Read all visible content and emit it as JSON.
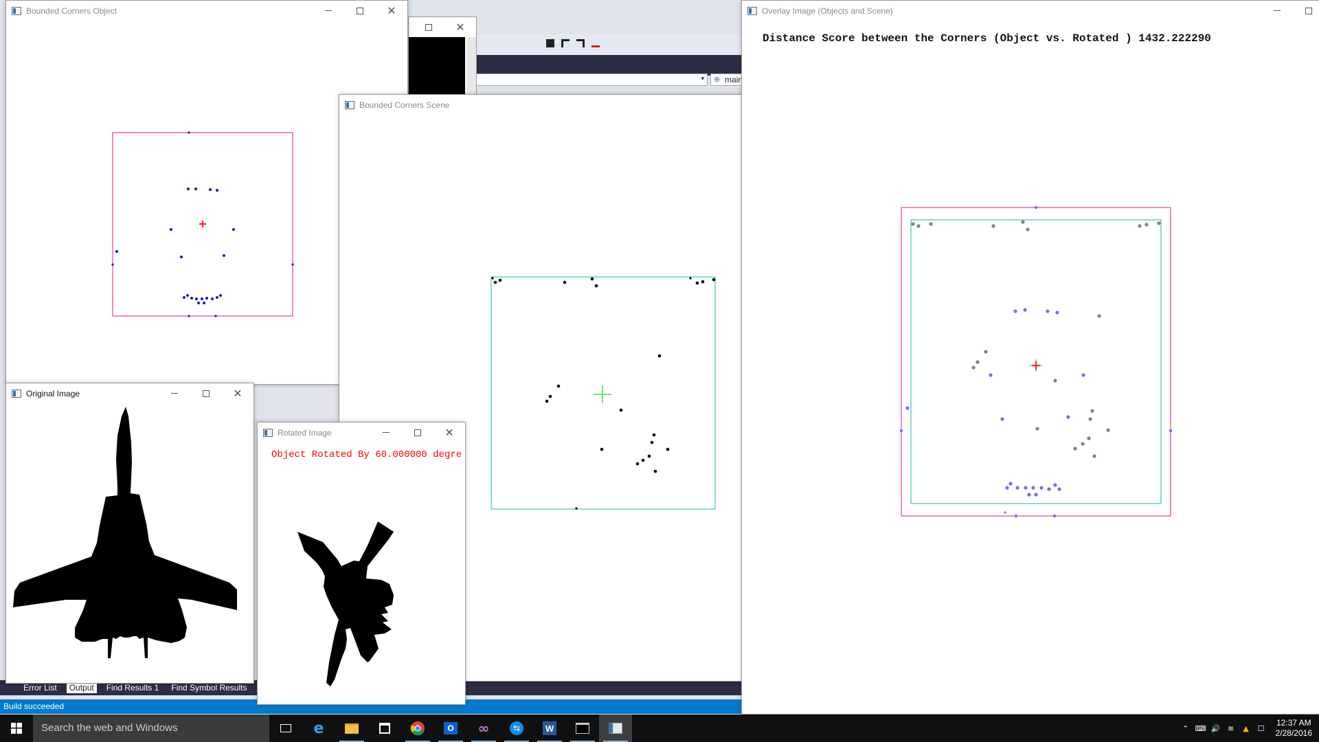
{
  "visual_studio": {
    "combo_text": "main",
    "bottom_tabs": [
      "Error List",
      "Output",
      "Find Results 1",
      "Find Symbol Results"
    ],
    "status": "Build succeeded"
  },
  "windows": {
    "bounded_object": {
      "title": "Bounded Corners Object"
    },
    "original": {
      "title": "Original Image"
    },
    "rotated": {
      "title": "Rotated Image",
      "caption": "Object Rotated By 60.000000 degre"
    },
    "bounded_scene": {
      "title": "Bounded Corners Scene"
    },
    "overlay": {
      "title": "Overlay Image (Objects and Scene)",
      "score_text": "Distance Score between the Corners (Object vs. Rotated ) 1432.222290"
    }
  },
  "colors": {
    "rect_magenta": "#e0409a",
    "rect_teal": "#3ec9a0",
    "object_dots": "#1010e0",
    "scene_dots": "#000000",
    "overlay_object_dots": "#7070f0",
    "overlay_scene_dots": "#808080",
    "crosshair_red": "#ff1a1a",
    "crosshair_green": "#4ad84a",
    "caption_red": "#ff0000",
    "status_bar": "#007acc"
  },
  "taskbar": {
    "search_placeholder": "Search the web and Windows",
    "apps": [
      "task-view",
      "edge",
      "file-explorer",
      "store",
      "chrome",
      "outlook",
      "visual-studio",
      "teamviewer",
      "word",
      "console",
      "opencv-window"
    ],
    "time": "12:37 AM",
    "date": "2/28/2016"
  }
}
